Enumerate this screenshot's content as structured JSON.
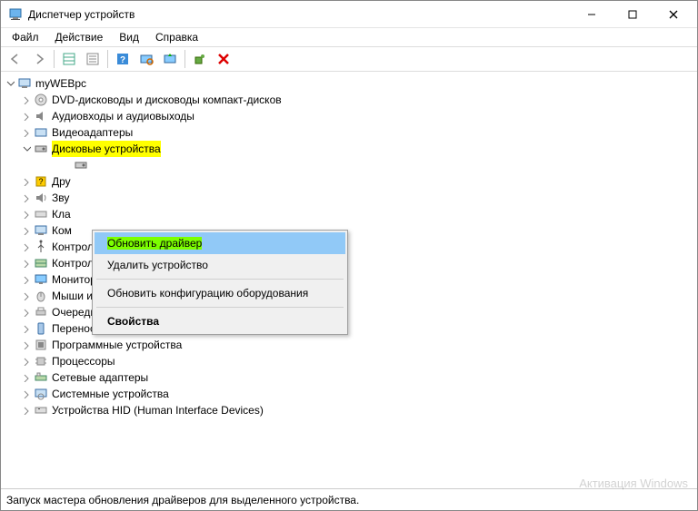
{
  "window": {
    "title": "Диспетчер устройств"
  },
  "menubar": {
    "file": "Файл",
    "action": "Действие",
    "view": "Вид",
    "help": "Справка"
  },
  "tree": {
    "root": "myWEBpc",
    "dvd": "DVD-дисководы и дисководы компакт-дисков",
    "audio": "Аудиовходы и аудиовыходы",
    "video": "Видеоадаптеры",
    "disk": "Дисковые устройства",
    "disk_child_prefix": "",
    "other": "Другие устройства",
    "sound": "Звуковые, игровые и видеоустройства",
    "keyboard": "Клавиатуры",
    "pc": "Компьютер",
    "usb": "Контроллеры USB",
    "storage": "Контроллеры запоминающих устройств",
    "monitor": "Мониторы",
    "mouse": "Мыши и иные указывающие устройства",
    "print": "Очереди печати",
    "portable": "Переносные устройства",
    "software": "Программные устройства",
    "cpu": "Процессоры",
    "net": "Сетевые адаптеры",
    "system": "Системные устройства",
    "hid": "Устройства HID (Human Interface Devices)"
  },
  "context": {
    "update": "Обновить драйвер",
    "delete": "Удалить устройство",
    "refresh": "Обновить конфигурацию оборудования",
    "props": "Свойства"
  },
  "status": "Запуск мастера обновления драйверов для выделенного устройства.",
  "watermark": "Активация Windows"
}
